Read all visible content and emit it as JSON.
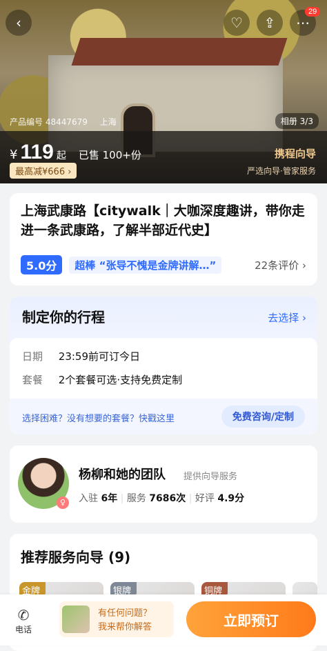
{
  "hero": {
    "product_id": "产品编号 48447679",
    "city": "上海",
    "album": "相册 3/3",
    "notif_count": "29",
    "currency": "¥",
    "price": "119",
    "price_suffix": "起",
    "sold": "已售 100+份",
    "reduce": "最高减¥666 ›",
    "guide_title": "携程向导",
    "guide_sub": "严选向导·管家服务"
  },
  "product": {
    "title": "上海武康路【citywalk｜大咖深度趣讲，带你走进一条武康路，了解半部近代史】",
    "score": "5.0分",
    "quote": "超棒 “张导不愧是金牌讲解…”",
    "reviews": "22条评价 ›"
  },
  "itinerary": {
    "title": "制定你的行程",
    "choose": "去选择 ›",
    "date_label": "日期",
    "date_value": "23:59前可订今日",
    "package_label": "套餐",
    "package_value": "2个套餐可选·支持免费定制",
    "help_text": "选择困难？没有想要的套餐？快戳这里",
    "help_button": "免费咨询/定制"
  },
  "team": {
    "name": "杨柳和她的团队",
    "service": "提供向导服务",
    "years_label": "入驻",
    "years": "6年",
    "served_label": "服务",
    "served": "7686次",
    "rating_label": "好评",
    "rating": "4.9分"
  },
  "recommend": {
    "title": "推荐服务向导 (9)",
    "medals": [
      "金牌",
      "银牌",
      "铜牌"
    ]
  },
  "bottom": {
    "phone": "电话",
    "ask_line1": "有任何问题？",
    "ask_line2": "我来帮你解答",
    "book": "立即预订"
  }
}
